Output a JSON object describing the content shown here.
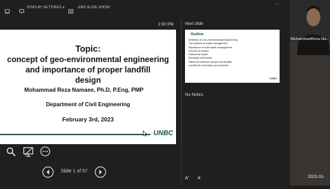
{
  "toolbar": {
    "display_settings": "DISPLAY SETTINGS ▾",
    "end_slide_show": "END SLIDE SHOW"
  },
  "presenter": {
    "time": "2:30 PM",
    "slide_counter": "Slide 1 of 57"
  },
  "current_slide": {
    "title": "Topic:",
    "subtitle_line1": "concept of geo-environmental engineering",
    "subtitle_line2": "and importance of proper landfill",
    "subtitle_line3": "design",
    "author": "Mohammad Reza Namaee, Ph.D, P.Eng, PMP",
    "department": "Department of Civil Engineering",
    "date": "February 3rd, 2023",
    "logo_text": "UNBC"
  },
  "next_panel": {
    "label": "Next slide",
    "title": "Outline",
    "items": [
      "Definition of Geo-environmental Engineering",
      "The problem of waste management",
      "Importance of solid waste management",
      "Sources of wastes",
      "Hazardous waste",
      "Municipal solid waste",
      "Difference between dumps and landfills",
      "Landfill site restrictions and selection"
    ],
    "logo_text": "UNBC",
    "notes": "No Notes."
  },
  "webcam": {
    "name": "MohammadReza Na...",
    "timestamp": "2023-02-"
  },
  "colors": {
    "background": "#1f1f1f",
    "slide_accent": "#1e5a35"
  }
}
